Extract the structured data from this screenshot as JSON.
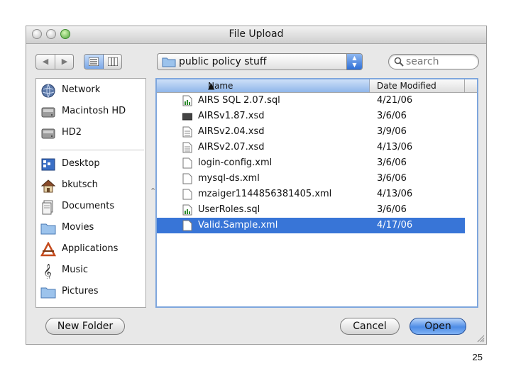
{
  "window": {
    "title": "File Upload"
  },
  "toolbar": {
    "back_glyph": "◀",
    "forward_glyph": "▶",
    "location": "public policy stuff",
    "search_placeholder": "search"
  },
  "sidebar": {
    "devices": [
      {
        "label": "Network",
        "icon": "globe-icon"
      },
      {
        "label": "Macintosh HD",
        "icon": "hard-drive-icon"
      },
      {
        "label": "HD2",
        "icon": "hard-drive-icon"
      }
    ],
    "places": [
      {
        "label": "Desktop",
        "icon": "desktop-icon"
      },
      {
        "label": "bkutsch",
        "icon": "home-icon"
      },
      {
        "label": "Documents",
        "icon": "documents-icon"
      },
      {
        "label": "Movies",
        "icon": "folder-icon"
      },
      {
        "label": "Applications",
        "icon": "applications-icon"
      },
      {
        "label": "Music",
        "icon": "music-icon"
      },
      {
        "label": "Pictures",
        "icon": "folder-icon"
      }
    ]
  },
  "file_list": {
    "columns": {
      "name": "Name",
      "date": "Date Modified"
    },
    "rows": [
      {
        "name": "AIRS SQL 2.07.sql",
        "date": "4/21/06",
        "icon": "sql-file-icon"
      },
      {
        "name": "AIRSv1.87.xsd",
        "date": "3/6/06",
        "icon": "dark-file-icon"
      },
      {
        "name": "AIRSv2.04.xsd",
        "date": "3/9/06",
        "icon": "text-file-icon"
      },
      {
        "name": "AIRSv2.07.xsd",
        "date": "4/13/06",
        "icon": "text-file-icon"
      },
      {
        "name": "login-config.xml",
        "date": "3/6/06",
        "icon": "blank-file-icon"
      },
      {
        "name": "mysql-ds.xml",
        "date": "3/6/06",
        "icon": "blank-file-icon"
      },
      {
        "name": "mzaiger1144856381405.xml",
        "date": "4/13/06",
        "icon": "blank-file-icon"
      },
      {
        "name": "UserRoles.sql",
        "date": "3/6/06",
        "icon": "sql-file-icon"
      },
      {
        "name": "Valid.Sample.xml",
        "date": "4/17/06",
        "icon": "blank-file-icon",
        "selected": true
      }
    ]
  },
  "buttons": {
    "new_folder": "New Folder",
    "cancel": "Cancel",
    "open": "Open"
  },
  "slide_number": "25",
  "colors": {
    "selection": "#3875d7",
    "accent": "#4e8ce6"
  }
}
